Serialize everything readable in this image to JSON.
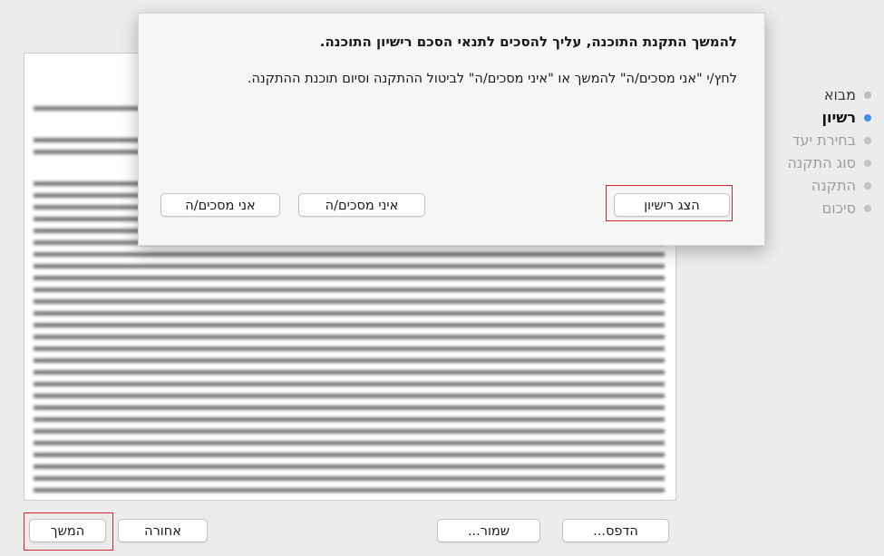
{
  "steps": [
    {
      "label": "מבוא"
    },
    {
      "label": "רשיון"
    },
    {
      "label": "בחירת יעד"
    },
    {
      "label": "סוג התקנה"
    },
    {
      "label": "התקנה"
    },
    {
      "label": "סיכום"
    }
  ],
  "dialog": {
    "title": "להמשך התקנת התוכנה, עליך להסכים לתנאי הסכם רישיון התוכנה.",
    "message": "לחץ/י \"אני מסכים/ה\" להמשך או \"איני מסכים/ה\" לביטול ההתקנה וסיום תוכנת ההתקנה.",
    "show_license_label": "הצג רישיון",
    "disagree_label": "איני מסכים/ה",
    "agree_label": "אני מסכים/ה"
  },
  "footer": {
    "print_label": "הדפס...",
    "save_label": "שמור...",
    "back_label": "אחורה",
    "continue_label": "המשך"
  },
  "colors": {
    "current_step": "#3f8ee8",
    "highlight": "#d0262c"
  }
}
